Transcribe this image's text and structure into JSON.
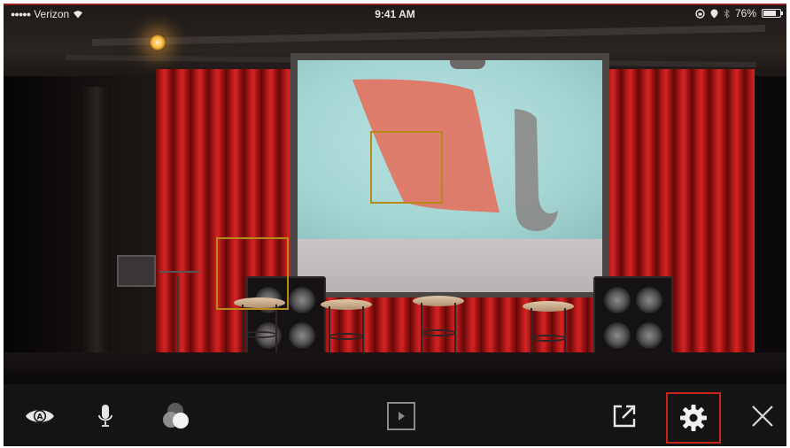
{
  "status_bar": {
    "carrier": "Verizon",
    "time": "9:41 AM",
    "battery_text": "76%",
    "battery_level": 0.76,
    "icons": [
      "signal-dots-icon",
      "wifi-icon",
      "rotation-lock-icon",
      "location-icon",
      "bluetooth-icon",
      "battery-icon"
    ]
  },
  "camera_view": {
    "focus_indicator_count": 2,
    "focus_color": "#b88a1a"
  },
  "toolbar": {
    "buttons": [
      {
        "name": "view-mode-button",
        "icon": "eye-a-icon"
      },
      {
        "name": "microphone-button",
        "icon": "microphone-icon"
      },
      {
        "name": "color-filter-button",
        "icon": "color-circles-icon"
      },
      {
        "name": "play-button",
        "icon": "play-icon"
      },
      {
        "name": "share-button",
        "icon": "share-external-icon"
      },
      {
        "name": "settings-button",
        "icon": "gear-icon",
        "highlighted": true
      },
      {
        "name": "close-button",
        "icon": "close-icon"
      }
    ],
    "highlight_color": "#c8231b"
  }
}
